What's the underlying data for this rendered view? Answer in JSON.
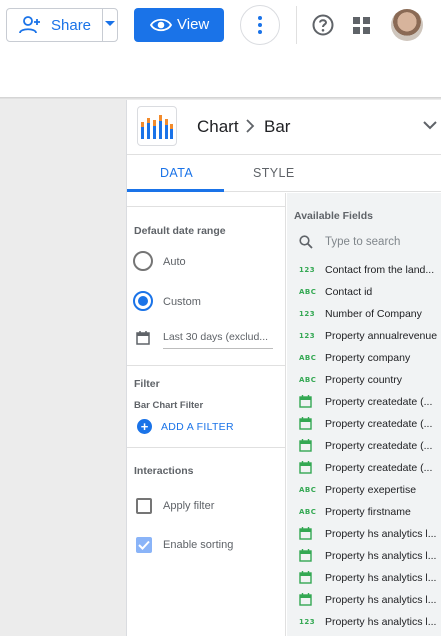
{
  "toolbar": {
    "share_label": "Share",
    "view_label": "View",
    "icons": [
      "person-add-icon",
      "chevron-down-icon",
      "eye-icon",
      "more-vert-icon",
      "help-icon",
      "apps-grid-icon"
    ]
  },
  "colors": {
    "accent": "#1a73e8",
    "type_green": "#34a853",
    "canvas_bg": "#ececec",
    "fields_bg": "#f1f3f4"
  },
  "panel": {
    "breadcrumb": {
      "chart": "Chart",
      "type": "Bar"
    },
    "tabs": [
      {
        "label": "DATA",
        "active": true
      },
      {
        "label": "STYLE",
        "active": false
      }
    ],
    "date_range": {
      "title": "Default date range",
      "options": [
        {
          "label": "Auto",
          "selected": false
        },
        {
          "label": "Custom",
          "selected": true
        }
      ],
      "value": "Last 30 days (exclud..."
    },
    "filter": {
      "title": "Filter",
      "subtitle": "Bar Chart Filter",
      "add_label": "ADD A FILTER"
    },
    "interactions": {
      "title": "Interactions",
      "options": [
        {
          "label": "Apply filter",
          "checked": false
        },
        {
          "label": "Enable sorting",
          "checked": true
        }
      ]
    },
    "available_fields": {
      "title": "Available Fields",
      "search_placeholder": "Type to search",
      "fields": [
        {
          "type": "123",
          "name": "Contact from the land..."
        },
        {
          "type": "ABC",
          "name": "Contact id"
        },
        {
          "type": "123",
          "name": "Number of Company"
        },
        {
          "type": "123",
          "name": "Property annualrevenue"
        },
        {
          "type": "ABC",
          "name": "Property company"
        },
        {
          "type": "ABC",
          "name": "Property country"
        },
        {
          "type": "date",
          "name": "Property createdate (..."
        },
        {
          "type": "date",
          "name": "Property createdate (..."
        },
        {
          "type": "date",
          "name": "Property createdate (..."
        },
        {
          "type": "date",
          "name": "Property createdate (..."
        },
        {
          "type": "ABC",
          "name": "Property exepertise"
        },
        {
          "type": "ABC",
          "name": "Property firstname"
        },
        {
          "type": "date",
          "name": "Property hs analytics l..."
        },
        {
          "type": "date",
          "name": "Property hs analytics l..."
        },
        {
          "type": "date",
          "name": "Property hs analytics l..."
        },
        {
          "type": "date",
          "name": "Property hs analytics l..."
        },
        {
          "type": "123",
          "name": "Property hs analytics l..."
        }
      ]
    }
  }
}
